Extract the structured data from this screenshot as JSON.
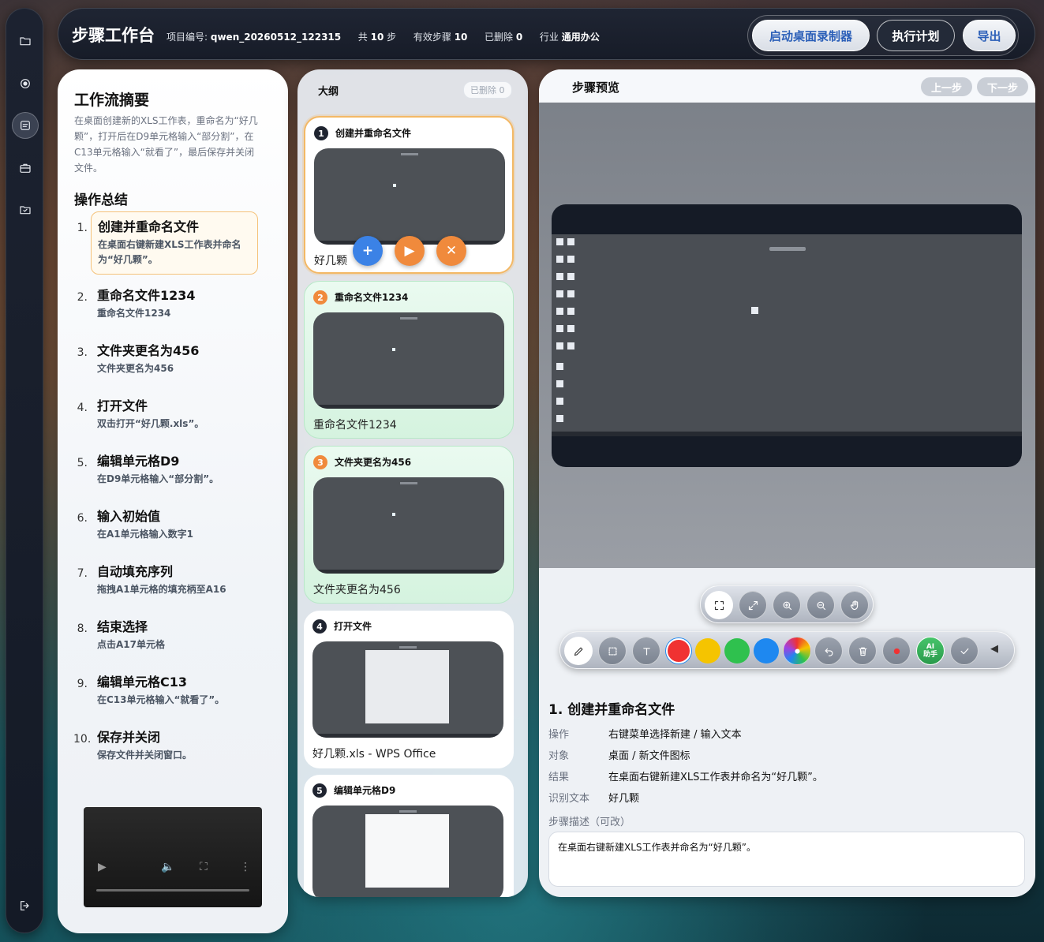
{
  "header": {
    "title": "步骤工作台",
    "project_label": "项目编号:",
    "project_id": "qwen_20260512_122315",
    "total_prefix": "共",
    "total_count": "10",
    "total_suffix": "步",
    "valid_label": "有效步骤",
    "valid_count": "10",
    "deleted_label": "已删除",
    "deleted_count": "0",
    "industry_label": "行业",
    "industry_value": "通用办公",
    "btn_recorder": "启动桌面录制器",
    "btn_execute": "执行计划",
    "btn_export": "导出"
  },
  "summary": {
    "title": "工作流摘要",
    "description": "在桌面创建新的XLS工作表，重命名为“好几颗”，打开后在D9单元格输入“部分割”，在C13单元格输入“就看了”，最后保存并关闭文件。",
    "ops_title": "操作总结",
    "ops": [
      {
        "num": "1.",
        "name": "创建并重命名文件",
        "detail": "在桌面右键新建XLS工作表并命名为“好几颗”。"
      },
      {
        "num": "2.",
        "name": "重命名文件1234",
        "detail": "重命名文件1234"
      },
      {
        "num": "3.",
        "name": "文件夹更名为456",
        "detail": "文件夹更名为456"
      },
      {
        "num": "4.",
        "name": "打开文件",
        "detail": "双击打开“好几颗.xls”。"
      },
      {
        "num": "5.",
        "name": "编辑单元格D9",
        "detail": "在D9单元格输入“部分割”。"
      },
      {
        "num": "6.",
        "name": "输入初始值",
        "detail": "在A1单元格输入数字1"
      },
      {
        "num": "7.",
        "name": "自动填充序列",
        "detail": "拖拽A1单元格的填充柄至A16"
      },
      {
        "num": "8.",
        "name": "结束选择",
        "detail": "点击A17单元格"
      },
      {
        "num": "9.",
        "name": "编辑单元格C13",
        "detail": "在C13单元格输入“就看了”。"
      },
      {
        "num": "10.",
        "name": "保存并关闭",
        "detail": "保存文件并关闭窗口。"
      }
    ]
  },
  "outline": {
    "title": "大纲",
    "deleted_badge": "已删除 0",
    "cards": [
      {
        "num": "1",
        "title": "创建并重命名文件",
        "caption": "好几颗",
        "color": "#1f2430"
      },
      {
        "num": "2",
        "title": "重命名文件1234",
        "caption": "重命名文件1234",
        "color": "#f08a3c"
      },
      {
        "num": "3",
        "title": "文件夹更名为456",
        "caption": "文件夹更名为456",
        "color": "#f08a3c"
      },
      {
        "num": "4",
        "title": "打开文件",
        "caption": "好几颗.xls - WPS Office",
        "color": "#1f2430"
      },
      {
        "num": "5",
        "title": "编辑单元格D9",
        "caption": "",
        "color": "#1f2430"
      }
    ]
  },
  "preview": {
    "title": "步骤预览",
    "prev": "上一步",
    "next": "下一步",
    "ai_label_1": "AI",
    "ai_label_2": "助手",
    "colors": [
      "#f03232",
      "#f5c400",
      "#2fc14e",
      "#1e88f0"
    ],
    "detail_title": "1. 创建并重命名文件",
    "rows": [
      {
        "key": "操作",
        "value": "右键菜单选择新建 / 输入文本"
      },
      {
        "key": "对象",
        "value": "桌面 / 新文件图标"
      },
      {
        "key": "结果",
        "value": "在桌面右键新建XLS工作表并命名为“好几颗”。"
      },
      {
        "key": "识别文本",
        "value": "好几颗"
      }
    ],
    "desc_label": "步骤描述（可改）",
    "desc_value": "在桌面右键新建XLS工作表并命名为“好几颗”。"
  }
}
